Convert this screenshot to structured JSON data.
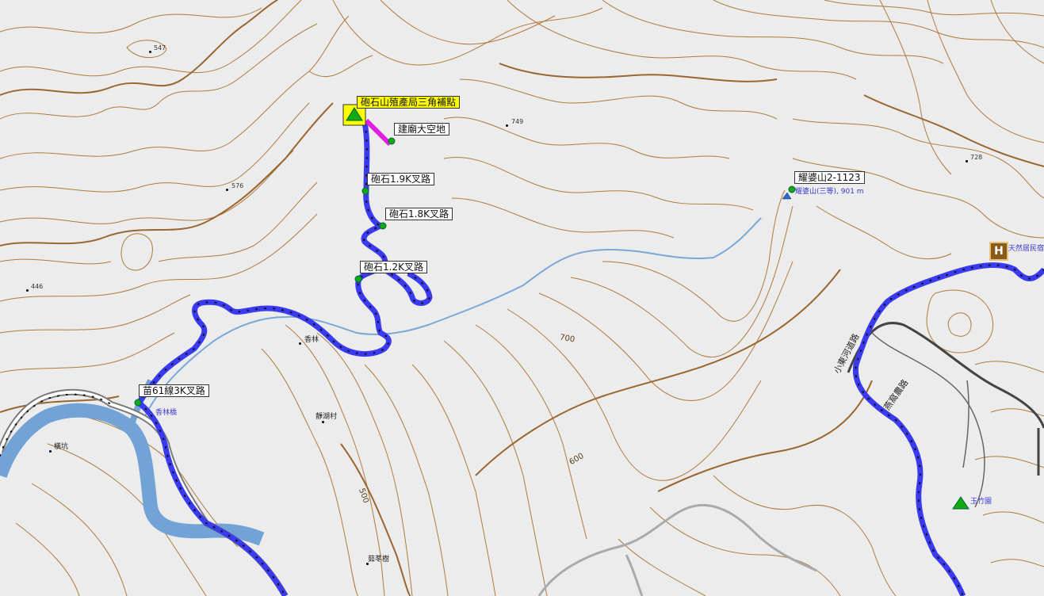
{
  "waypoints": {
    "summit": "砲石山殖產局三角補點",
    "open_area": "建廟大空地",
    "junction_19k": "砲石1.9K叉路",
    "junction_18k": "砲石1.8K叉路",
    "junction_12k": "砲石1.2K叉路",
    "junction_miao61": "苗61線3K叉路",
    "yaopo": "耀婆山2-1123"
  },
  "spot_heights": {
    "h547": "547",
    "h749": "749",
    "h576": "576",
    "h728": "728",
    "h446": "446"
  },
  "places": {
    "xianglin": "香林",
    "jinghu": "靜湖村",
    "hengkeng": "橫坑",
    "ruqinshu": "茹苳樹"
  },
  "pois": {
    "xianglin_bridge": "香林橋",
    "yaopo_peak": "耀婆山(三等), 901 m",
    "yuzhuyuan": "玉竹園",
    "tianran_minsu": "天然居民宿"
  },
  "contours": {
    "c700": "700",
    "c600": "600",
    "c500": "500"
  },
  "roads": {
    "road_a": "小東河道路",
    "road_b": "燕窩農路"
  },
  "colors": {
    "background": "#ececec",
    "contour": "#b07a3c",
    "contour_index": "#9a6630",
    "track": "#3a3af0",
    "stream": "#7aa7d8",
    "river": "#72a3d6",
    "road_casing": "#7a7a7a",
    "highlight": "#ffff00",
    "waypoint": "#11aa11"
  },
  "icons": {
    "summit_marker": "green-triangle-icon",
    "peak_marker": "mountain-icon",
    "hotel_marker": "hotel-icon",
    "camp_marker": "tent-icon",
    "waypoint_marker": "green-dot-icon"
  }
}
